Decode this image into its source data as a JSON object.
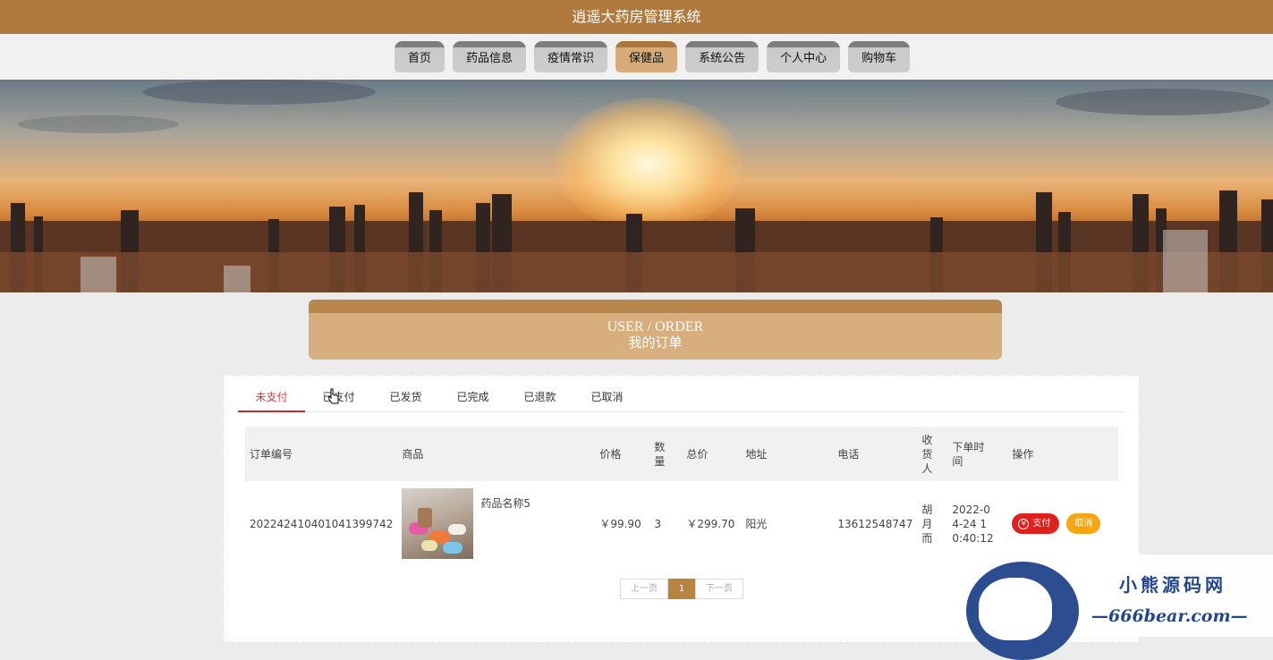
{
  "app": {
    "title": "逍遥大药房管理系统"
  },
  "nav": {
    "items": [
      {
        "label": "首页"
      },
      {
        "label": "药品信息"
      },
      {
        "label": "疫情常识"
      },
      {
        "label": "保健品"
      },
      {
        "label": "系统公告"
      },
      {
        "label": "个人中心"
      },
      {
        "label": "购物车"
      }
    ],
    "active": "保健品"
  },
  "banner": {
    "icon": "city-sunset-image"
  },
  "section": {
    "title_en": "USER / ORDER",
    "title_cn": "我的订单"
  },
  "tabs": [
    {
      "label": "未支付",
      "active": true
    },
    {
      "label": "已支付"
    },
    {
      "label": "已发货"
    },
    {
      "label": "已完成"
    },
    {
      "label": "已退款"
    },
    {
      "label": "已取消"
    }
  ],
  "table": {
    "headers": {
      "order_no": "订单编号",
      "product": "商品",
      "price": "价格",
      "qty": "数量",
      "total": "总价",
      "address": "地址",
      "phone": "电话",
      "receiver": "收货人",
      "time": "下单时间",
      "ops": "操作"
    },
    "rows": [
      {
        "order_no": "202242410401041399742",
        "product_name": "药品名称5",
        "price": "￥99.90",
        "qty": "3",
        "total": "￥299.70",
        "address": "阳光",
        "phone": "13612548747",
        "receiver": "胡月而",
        "time": "2022-04-24 10:40:12",
        "pay_label": "支付",
        "cancel_label": "取消"
      }
    ]
  },
  "pager": {
    "prev": "上一页",
    "current": "1",
    "next": "下一页"
  },
  "watermark": {
    "title": "小熊源码网",
    "url": "—666bear.com—"
  },
  "colors": {
    "brand": "#b07a3e",
    "active_tab": "#c52b2b",
    "pay": "#e0201c",
    "cancel": "#f5a611"
  }
}
